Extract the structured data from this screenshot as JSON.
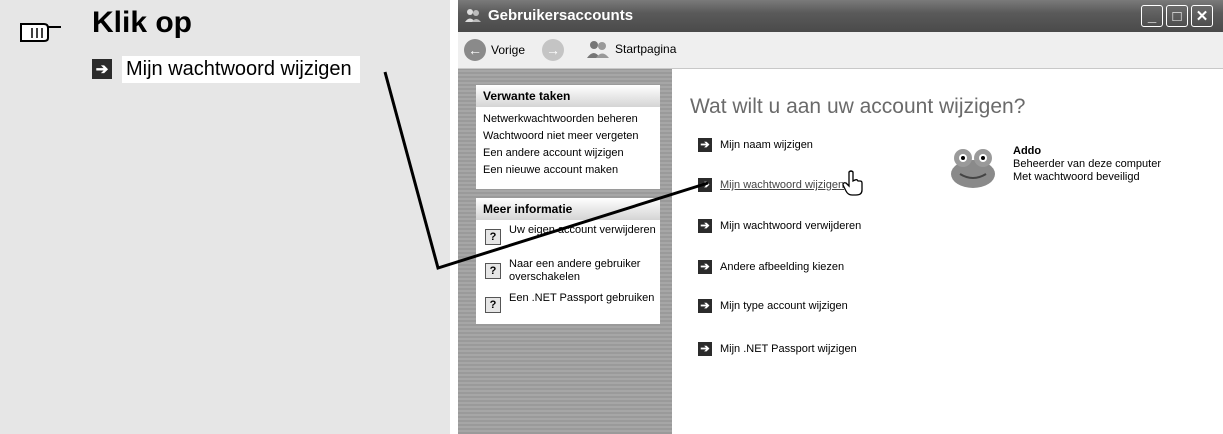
{
  "instruction": {
    "title": "Klik op",
    "item": "Mijn wachtwoord wijzigen"
  },
  "window": {
    "title": "Gebruikersaccounts",
    "buttons": {
      "minimize": "_",
      "maximize": "□",
      "close": "✕"
    }
  },
  "nav": {
    "back": "Vorige",
    "home": "Startpagina"
  },
  "sidebar": {
    "related_title": "Verwante taken",
    "related_links": [
      "Netwerkwachtwoorden beheren",
      "Wachtwoord niet meer vergeten",
      "Een andere account wijzigen",
      "Een nieuwe account maken"
    ],
    "info_title": "Meer informatie",
    "info_links": [
      "Uw eigen account verwijderen",
      "Naar een andere gebruiker overschakelen",
      "Een .NET Passport gebruiken"
    ]
  },
  "main": {
    "heading": "Wat wilt u aan uw account wijzigen?",
    "tasks": [
      "Mijn naam wijzigen",
      "Mijn wachtwoord wijzigen",
      "Mijn wachtwoord verwijderen",
      "Andere afbeelding kiezen",
      "Mijn type account wijzigen",
      "Mijn .NET Passport wijzigen"
    ]
  },
  "user": {
    "name": "Addo",
    "role": "Beheerder van deze computer",
    "status": "Met wachtwoord beveiligd"
  },
  "icons": {
    "arrow": "arrow-right-icon",
    "help": "help-icon",
    "hand": "pointing-hand-icon"
  }
}
